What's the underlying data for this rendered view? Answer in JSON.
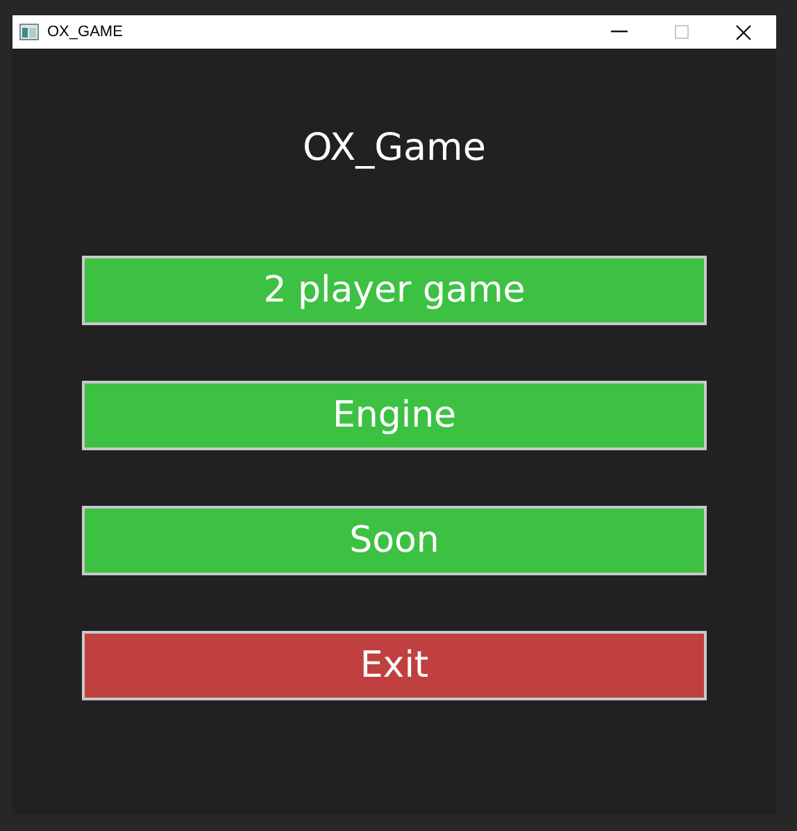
{
  "window": {
    "title": "OX_GAME"
  },
  "heading": "OX_Game",
  "buttons": [
    {
      "label": "2 player game",
      "color": "#3dc143"
    },
    {
      "label": "Engine",
      "color": "#3dc143"
    },
    {
      "label": "Soon",
      "color": "#3dc143"
    },
    {
      "label": "Exit",
      "color": "#c04040"
    }
  ]
}
